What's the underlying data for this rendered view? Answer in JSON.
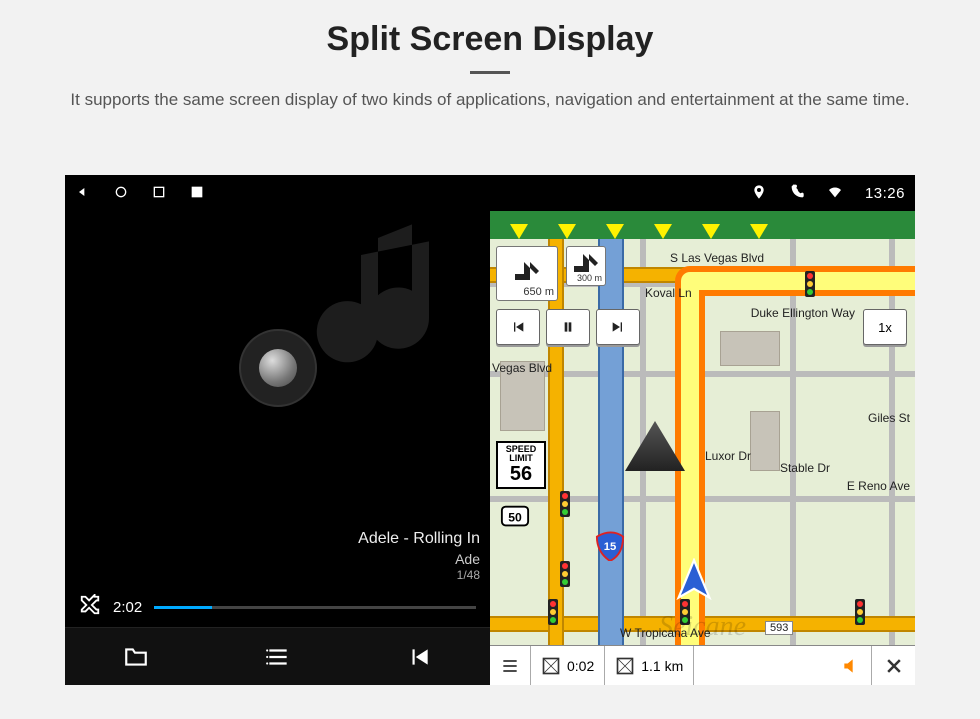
{
  "heading": {
    "title": "Split Screen Display",
    "subtitle": "It supports the same screen display of two kinds of applications, navigation and entertainment at the same time."
  },
  "sysbar": {
    "clock": "13:26"
  },
  "music": {
    "track_line1": "Adele - Rolling In",
    "track_line2": "Ade",
    "track_index": "1/48",
    "elapsed": "2:02"
  },
  "nav": {
    "streets": {
      "top": "S Las Vegas Blvd",
      "duke": "Duke Ellington Way",
      "koval": "Koval Ln",
      "luxor": "Luxor Dr",
      "reno": "E Reno Ave",
      "stable": "Stable Dr",
      "giles": "Giles St",
      "bottom": "W Tropicana Ave",
      "bottom_no": "593",
      "vegas": "Vegas Blvd"
    },
    "turn": {
      "main_dist": "650 m",
      "next_dist": "300 m"
    },
    "speed_limit": {
      "label": "SPEED\nLIMIT",
      "value": "56"
    },
    "highway": "50",
    "interstate": "15",
    "playback_speed": "1x",
    "bottom": {
      "time": "0:02",
      "distance": "1.1 km"
    },
    "watermark": "Seicane"
  }
}
